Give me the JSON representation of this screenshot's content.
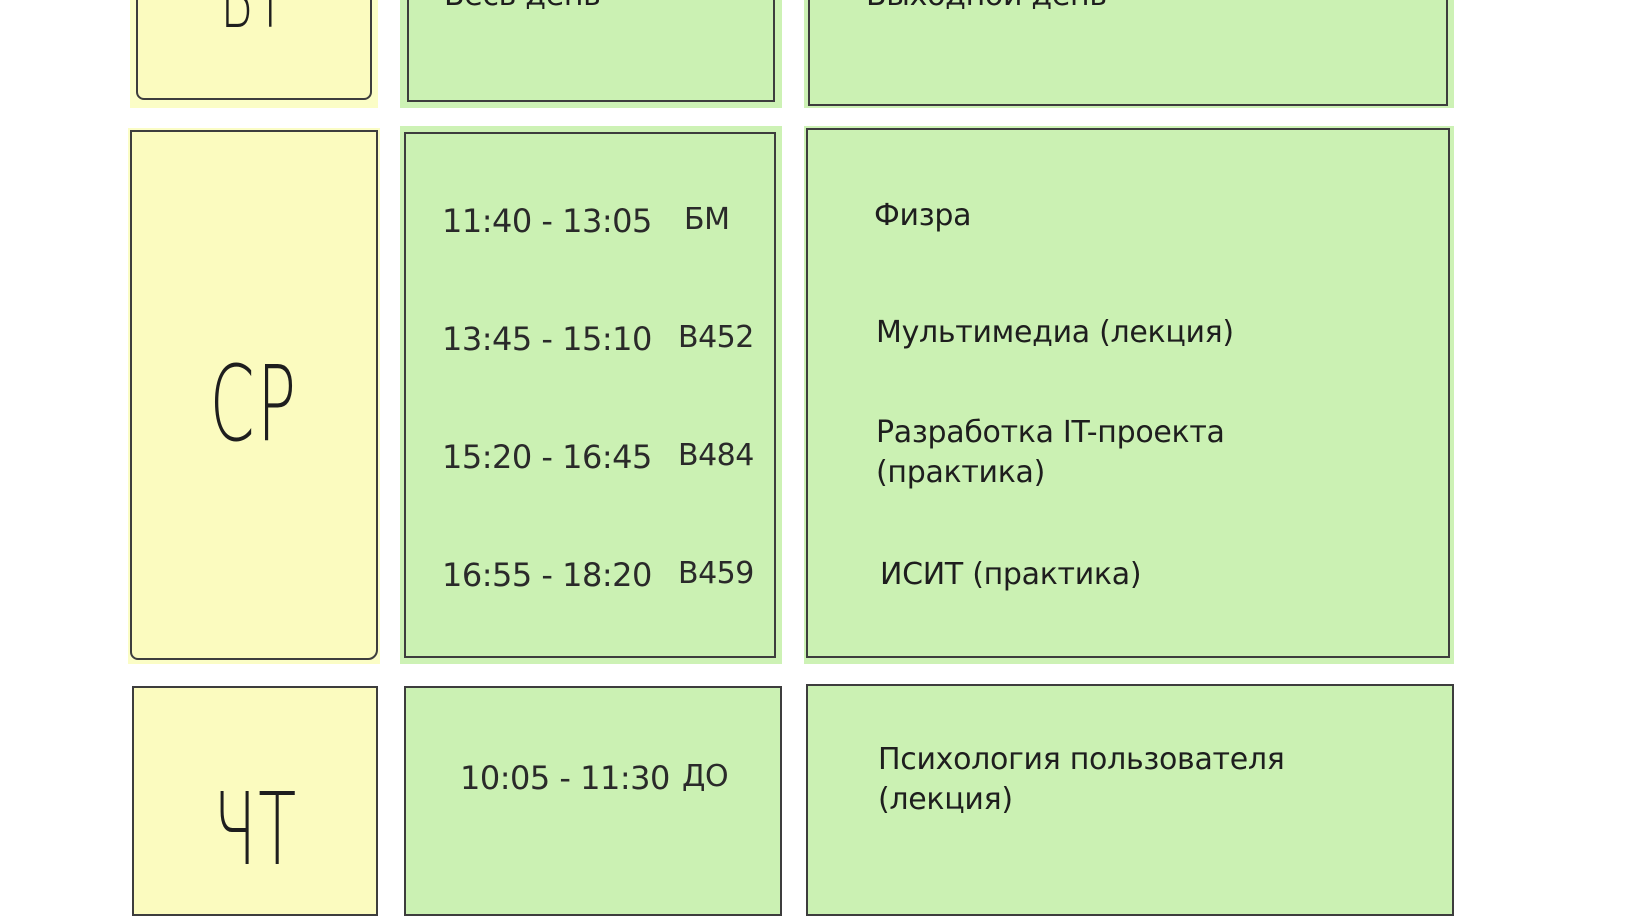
{
  "colors": {
    "day_card": "#fbfbbf",
    "schedule_card": "#cbf1b3",
    "border": "#3d3d3d"
  },
  "rows": [
    {
      "day": "ВТ",
      "times_header": "Весь день",
      "subjects_header": "Выходной день"
    },
    {
      "day": "СР",
      "lessons": [
        {
          "time": "11:40 - 13:05",
          "room": "БМ",
          "subject_lines": [
            "Физра"
          ]
        },
        {
          "time": "13:45 - 15:10",
          "room": "В452",
          "subject_lines": [
            "Мультимедиа (лекция)"
          ]
        },
        {
          "time": "15:20 - 16:45",
          "room": "В484",
          "subject_lines": [
            "Разработка IT-проекта",
            "(практика)"
          ]
        },
        {
          "time": "16:55 - 18:20",
          "room": "В459",
          "subject_lines": [
            "ИСИТ (практика)"
          ]
        }
      ]
    },
    {
      "day": "ЧТ",
      "lessons": [
        {
          "time": "10:05 - 11:30",
          "room": "ДО",
          "subject_lines": [
            "Психология пользователя",
            "(лекция)"
          ]
        }
      ]
    }
  ]
}
